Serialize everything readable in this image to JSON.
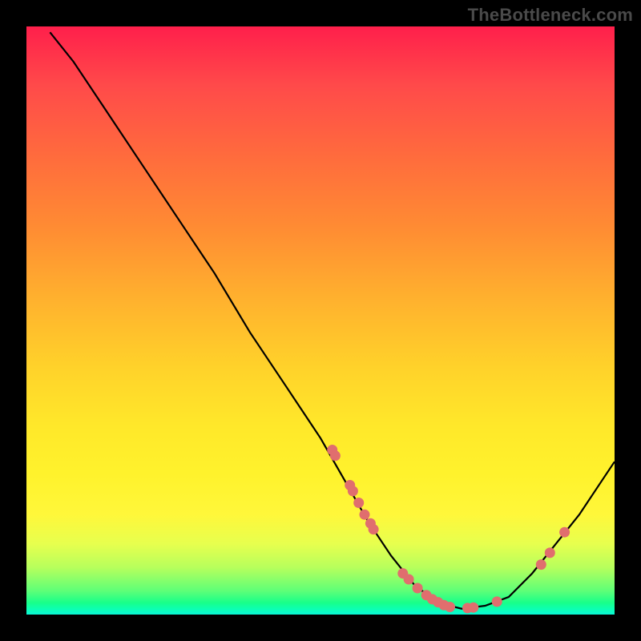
{
  "watermark": "TheBottleneck.com",
  "colors": {
    "dot": "#e06e6e",
    "curve": "#000000",
    "frame": "#000000"
  },
  "chart_data": {
    "type": "line",
    "title": "",
    "xlabel": "",
    "ylabel": "",
    "xlim": [
      0,
      100
    ],
    "ylim": [
      0,
      100
    ],
    "grid": false,
    "legend": false,
    "curve": [
      {
        "x": 4,
        "y": 99
      },
      {
        "x": 8,
        "y": 94
      },
      {
        "x": 14,
        "y": 85
      },
      {
        "x": 20,
        "y": 76
      },
      {
        "x": 26,
        "y": 67
      },
      {
        "x": 32,
        "y": 58
      },
      {
        "x": 38,
        "y": 48
      },
      {
        "x": 44,
        "y": 39
      },
      {
        "x": 50,
        "y": 30
      },
      {
        "x": 54,
        "y": 23
      },
      {
        "x": 58,
        "y": 16
      },
      {
        "x": 62,
        "y": 10
      },
      {
        "x": 66,
        "y": 5
      },
      {
        "x": 70,
        "y": 2
      },
      {
        "x": 74,
        "y": 1
      },
      {
        "x": 78,
        "y": 1.5
      },
      {
        "x": 82,
        "y": 3
      },
      {
        "x": 86,
        "y": 7
      },
      {
        "x": 90,
        "y": 12
      },
      {
        "x": 94,
        "y": 17
      },
      {
        "x": 98,
        "y": 23
      },
      {
        "x": 100,
        "y": 26
      }
    ],
    "points": [
      {
        "x": 52,
        "y": 28
      },
      {
        "x": 52.5,
        "y": 27
      },
      {
        "x": 55,
        "y": 22
      },
      {
        "x": 55.5,
        "y": 21
      },
      {
        "x": 56.5,
        "y": 19
      },
      {
        "x": 57.5,
        "y": 17
      },
      {
        "x": 58.5,
        "y": 15.5
      },
      {
        "x": 59,
        "y": 14.5
      },
      {
        "x": 64,
        "y": 7
      },
      {
        "x": 65,
        "y": 6
      },
      {
        "x": 66.5,
        "y": 4.5
      },
      {
        "x": 68,
        "y": 3.3
      },
      {
        "x": 69,
        "y": 2.6
      },
      {
        "x": 70,
        "y": 2.1
      },
      {
        "x": 71,
        "y": 1.6
      },
      {
        "x": 72,
        "y": 1.3
      },
      {
        "x": 75,
        "y": 1.1
      },
      {
        "x": 76,
        "y": 1.2
      },
      {
        "x": 80,
        "y": 2.2
      },
      {
        "x": 87.5,
        "y": 8.5
      },
      {
        "x": 89,
        "y": 10.5
      },
      {
        "x": 91.5,
        "y": 14
      }
    ]
  }
}
